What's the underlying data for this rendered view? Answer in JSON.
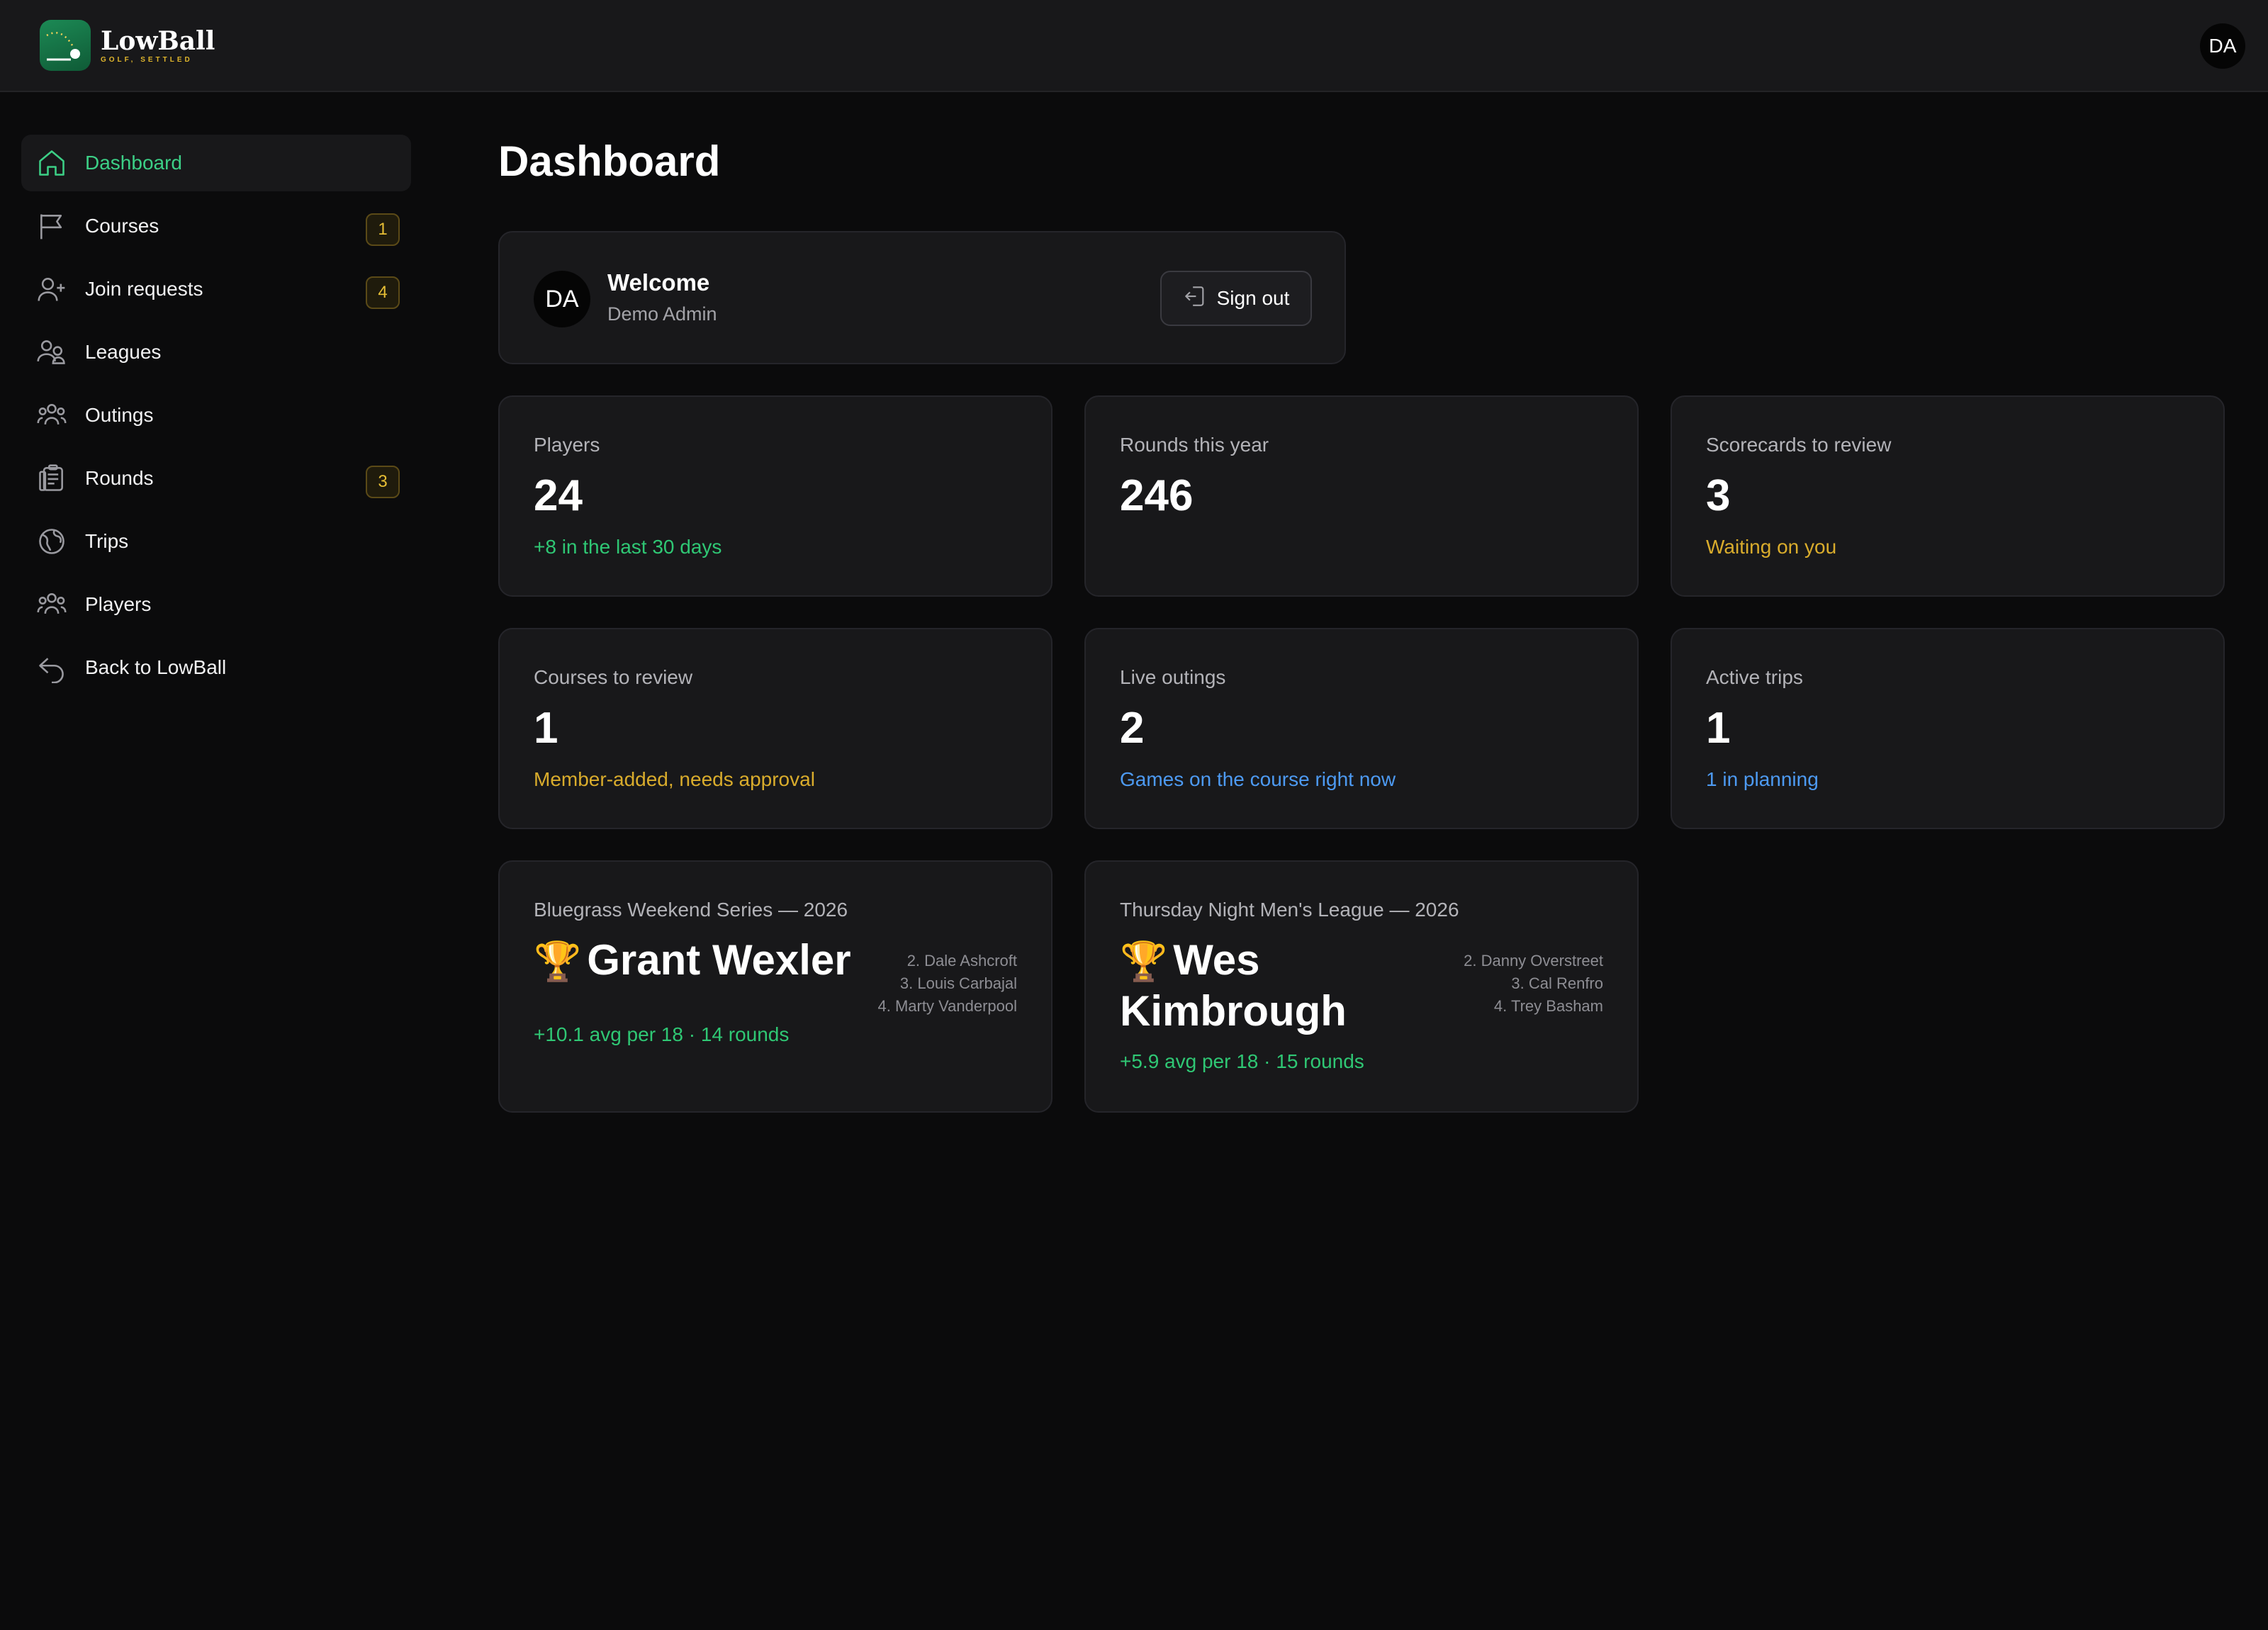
{
  "brand": {
    "name": "LowBall",
    "tagline": "GOLF, SETTLED",
    "accent": "#3ccf86",
    "logo_green": "#1c8a55"
  },
  "user": {
    "initials": "DA",
    "name": "Demo Admin"
  },
  "sidebar": {
    "items": [
      {
        "label": "Dashboard",
        "icon": "home-icon",
        "active": true,
        "badge": ""
      },
      {
        "label": "Courses",
        "icon": "flag-icon",
        "active": false,
        "badge": "1"
      },
      {
        "label": "Join requests",
        "icon": "user-plus-icon",
        "active": false,
        "badge": "4"
      },
      {
        "label": "Leagues",
        "icon": "users-icon",
        "active": false,
        "badge": ""
      },
      {
        "label": "Outings",
        "icon": "group-icon",
        "active": false,
        "badge": ""
      },
      {
        "label": "Rounds",
        "icon": "clipboard-icon",
        "active": false,
        "badge": "3"
      },
      {
        "label": "Trips",
        "icon": "globe-icon",
        "active": false,
        "badge": ""
      },
      {
        "label": "Players",
        "icon": "players-icon",
        "active": false,
        "badge": ""
      },
      {
        "label": "Back to LowBall",
        "icon": "back-arrow-icon",
        "active": false,
        "badge": ""
      }
    ]
  },
  "main": {
    "title": "Dashboard",
    "welcome": {
      "title": "Welcome",
      "name": "Demo Admin",
      "signout_label": "Sign out"
    },
    "stats": [
      {
        "label": "Players",
        "value": "24",
        "note": "+8 in the last 30 days",
        "note_color": "green"
      },
      {
        "label": "Rounds this year",
        "value": "246",
        "note": "",
        "note_color": ""
      },
      {
        "label": "Scorecards to review",
        "value": "3",
        "note": "Waiting on you",
        "note_color": "yellow"
      },
      {
        "label": "Courses to review",
        "value": "1",
        "note": "Member-added, needs approval",
        "note_color": "yellow"
      },
      {
        "label": "Live outings",
        "value": "2",
        "note": "Games on the course right now",
        "note_color": "blue"
      },
      {
        "label": "Active trips",
        "value": "1",
        "note": "1 in planning",
        "note_color": "blue"
      }
    ],
    "leagues": [
      {
        "title": "Bluegrass Weekend Series — 2026",
        "winner_line1": "Grant Wexler",
        "winner_line2": "",
        "runners": [
          "2. Dale Ashcroft",
          "3. Louis Carbajal",
          "4. Marty Vanderpool"
        ],
        "note": "+10.1 avg per 18 · 14 rounds"
      },
      {
        "title": "Thursday Night Men's League — 2026",
        "winner_line1": "Wes",
        "winner_line2": "Kimbrough",
        "runners": [
          "2. Danny Overstreet",
          "3. Cal Renfro",
          "4. Trey Basham"
        ],
        "note": "+5.9 avg per 18 · 15 rounds"
      }
    ]
  }
}
